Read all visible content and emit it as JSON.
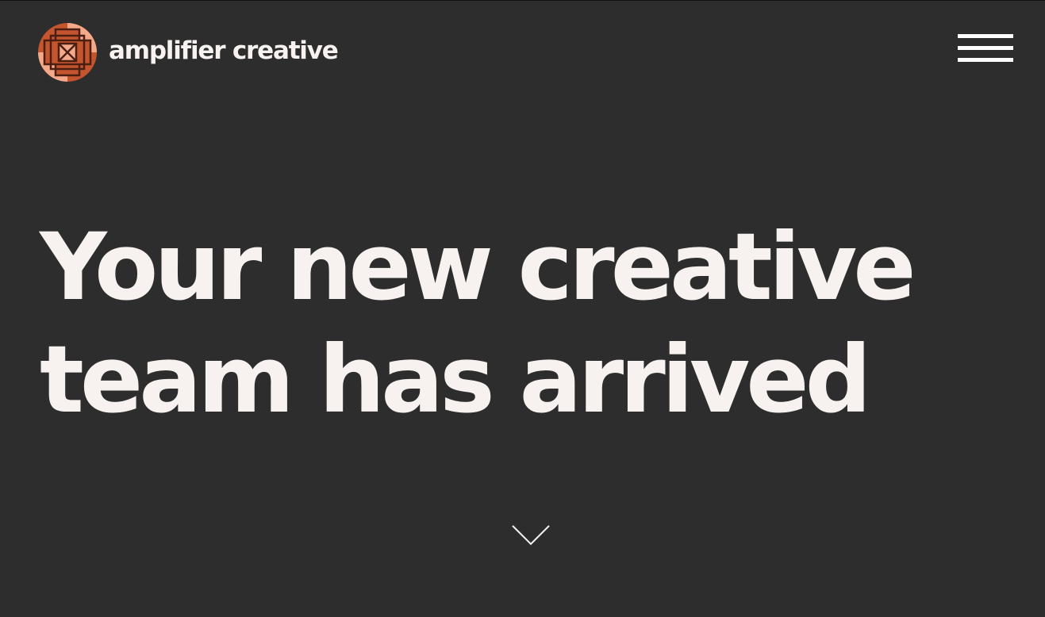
{
  "brand": {
    "name": "amplifier creative",
    "logo_icon": "amplifier-creative-logo",
    "colors": {
      "logo_primary": "#c4552f",
      "logo_secondary": "#f4a98a",
      "logo_outline": "#4a1f12"
    }
  },
  "header": {
    "menu_icon": "hamburger-menu-icon"
  },
  "hero": {
    "title_line_1": "Your new creative",
    "title_line_2": "team has arrived"
  },
  "scroll": {
    "icon": "chevron-down-icon"
  },
  "theme": {
    "background": "#2d2d2d",
    "text": "#f7f2f0"
  }
}
